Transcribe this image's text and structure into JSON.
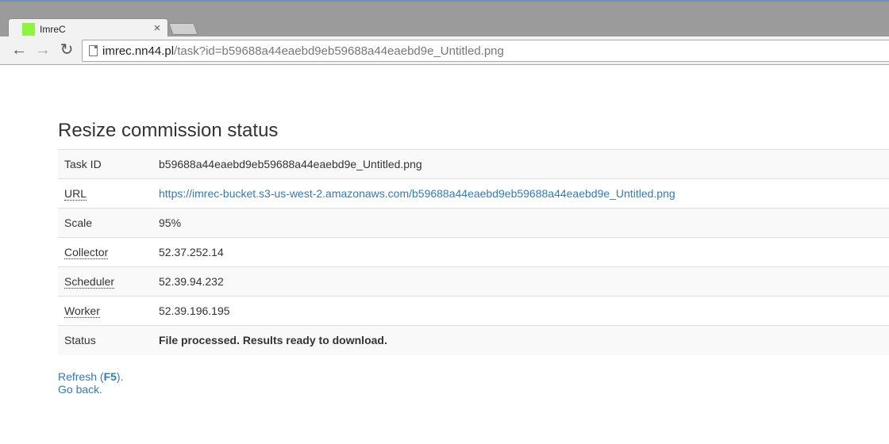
{
  "browser": {
    "tab_title": "ImreC",
    "tab_close": "×",
    "favicon_color": "#8cf53f",
    "url_host": "imrec.nn44.pl",
    "url_path": "/task?id=b59688a44eaebd9eb59688a44eaebd9e_Untitled.png",
    "back_icon": "←",
    "forward_icon": "→",
    "reload_icon": "↻"
  },
  "page": {
    "title": "Resize commission status",
    "rows": [
      {
        "label": "Task ID",
        "value": "b59688a44eaebd9eb59688a44eaebd9e_Untitled.png"
      },
      {
        "label": "URL",
        "value": "https://imrec-bucket.s3-us-west-2.amazonaws.com/b59688a44eaebd9eb59688a44eaebd9e_Untitled.png"
      },
      {
        "label": "Scale",
        "value": "95%"
      },
      {
        "label": "Collector",
        "value": "52.37.252.14"
      },
      {
        "label": "Scheduler",
        "value": "52.39.94.232"
      },
      {
        "label": "Worker",
        "value": "52.39.196.195"
      },
      {
        "label": "Status",
        "value": "File processed. Results ready to download."
      }
    ],
    "refresh_prefix": "Refresh (",
    "refresh_key": "F5",
    "refresh_suffix": ").",
    "go_back": "Go back."
  },
  "colors": {
    "link": "#337ab7",
    "text": "#333333",
    "row_stripe": "#f9f9f9",
    "chrome": "#9b9b9b"
  }
}
